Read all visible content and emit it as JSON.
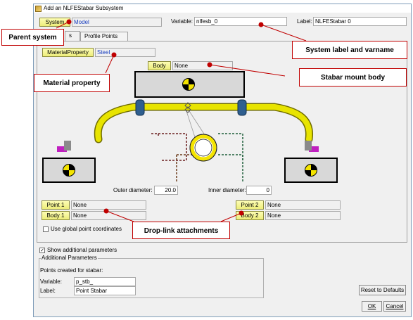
{
  "window": {
    "title": "Add an NLFEStabar Subsystem"
  },
  "system": {
    "button_label": "System",
    "value": "Model"
  },
  "variable": {
    "label": "Variable:",
    "value": "nlfesb_0"
  },
  "label_field": {
    "label": "Label:",
    "value": "NLFEStabar 0"
  },
  "tabs": [
    {
      "label": "s"
    },
    {
      "label": "Profile Points"
    }
  ],
  "material": {
    "button_label": "MaterialProperty",
    "value": "Steel"
  },
  "body": {
    "button_label": "Body",
    "value": "None"
  },
  "diagram": {
    "outer_label": "Outer diameter:",
    "outer_value": "20.0",
    "inner_label": "Inner diameter:",
    "inner_value": "0"
  },
  "left_attach": {
    "point_label": "Point 1",
    "point_value": "None",
    "body_label": "Body 1",
    "body_value": "None"
  },
  "right_attach": {
    "point_label": "Point 2",
    "point_value": "None",
    "body_label": "Body 2",
    "body_value": "None"
  },
  "global_coords": {
    "label": "Use global point coordinates",
    "checked": false
  },
  "show_additional": {
    "label": "Show additional parameters",
    "checked": true
  },
  "additional": {
    "title": "Additional Parameters",
    "subtitle": "Points created for stabar:",
    "variable_label": "Variable:",
    "variable_value": "p_stb_",
    "label_label": "Label:",
    "label_value": "Point Stabar"
  },
  "buttons": {
    "reset": "Reset to Defaults",
    "ok": "OK",
    "cancel": "Cancel"
  },
  "callouts": {
    "parent": "Parent system",
    "system_label": "System label and varname",
    "material": "Material property",
    "stabar_mount": "Stabar mount body",
    "droplink": "Drop-link attachments"
  },
  "colors": {
    "callout_border": "#c00000",
    "button_yellow": "#f2f29a",
    "bar_yellow": "#e8e400",
    "bushing_blue": "#2f5f8f",
    "link_magenta": "#c020c0"
  }
}
